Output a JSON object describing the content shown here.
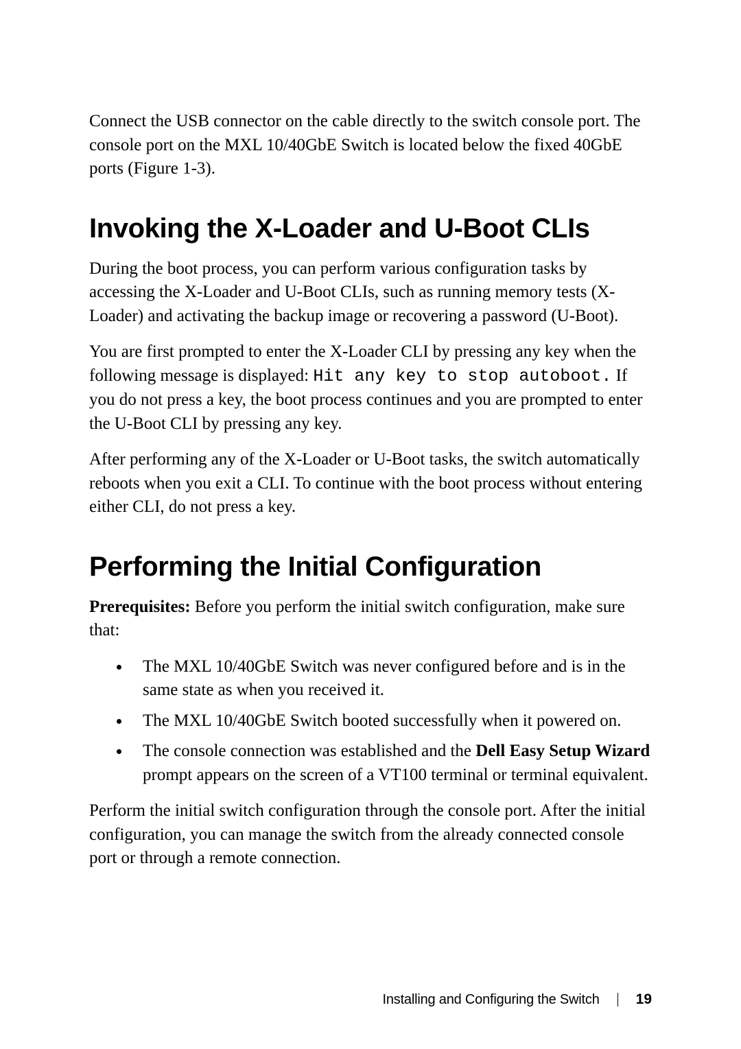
{
  "intro_paragraph": "Connect the USB connector on the cable directly to the switch console port. The console port on the MXL 10/40GbE Switch is located below the fixed 40GbE ports (Figure 1-3).",
  "section1": {
    "heading": "Invoking the X-Loader and U-Boot CLIs",
    "p1": "During the boot process, you can perform various configuration tasks by accessing the X-Loader and U-Boot CLIs, such as running memory tests (X-Loader) and activating the backup image or recovering a password (U-Boot).",
    "p2a": "You are first prompted to enter the X-Loader CLI by pressing any key when the following message is displayed: ",
    "p2_code": "Hit any key to stop autoboot.",
    "p2b": " If you do not press a key, the boot process continues and you are prompted to enter the U-Boot CLI by pressing any key.",
    "p3": "After performing any of the X-Loader or U-Boot tasks, the switch automatically reboots when you exit a CLI. To continue with the boot process without entering either CLI, do not press a key."
  },
  "section2": {
    "heading": "Performing the Initial Configuration",
    "prereq_label": "Prerequisites:",
    "prereq_text": " Before you perform the initial switch configuration, make sure that:",
    "bullets": [
      "The MXL 10/40GbE Switch was never configured before and is in the same state as when you received it.",
      "The MXL 10/40GbE Switch booted successfully when it powered on."
    ],
    "bullet3_a": "The console connection was established and the ",
    "bullet3_bold": "Dell Easy Setup Wizard",
    "bullet3_b": " prompt appears on the screen of a VT100 terminal or terminal equivalent.",
    "p_after_list": "Perform the initial switch configuration through the console port. After the initial configuration, you can manage the switch from the already connected console port or through a remote connection."
  },
  "footer": {
    "section_name": "Installing and Configuring the Switch",
    "page_number": "19"
  }
}
